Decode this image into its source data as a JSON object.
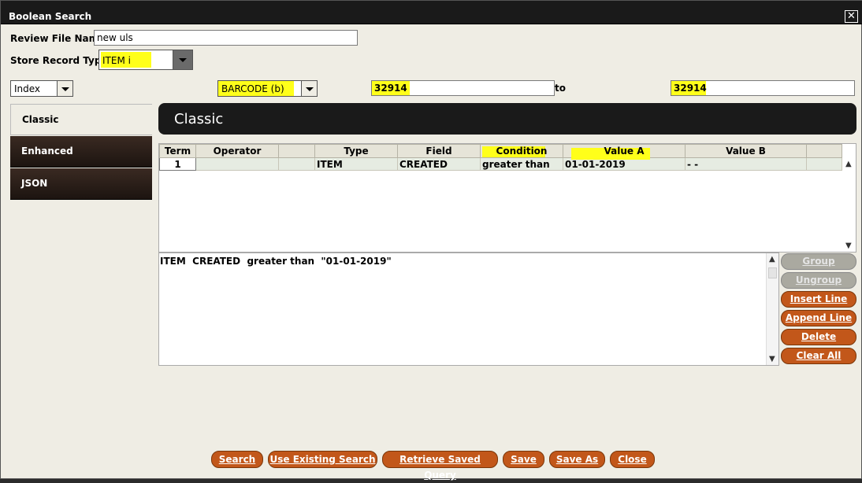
{
  "window": {
    "title": "Boolean Search"
  },
  "review": {
    "label": "Review File Name:",
    "value": "new uls"
  },
  "store": {
    "label": "Store Record Type:",
    "value": "ITEM i"
  },
  "index": {
    "value": "Index"
  },
  "barcode": {
    "value": "BARCODE (b)"
  },
  "range": {
    "from": "32914",
    "to_label": "to",
    "to": "32914"
  },
  "tabs": [
    {
      "label": "Classic"
    },
    {
      "label": "Enhanced"
    },
    {
      "label": "JSON"
    }
  ],
  "banner": {
    "title": "Classic"
  },
  "grid": {
    "headers": [
      "Term",
      "Operator",
      "",
      "Type",
      "Field",
      "Condition",
      "Value A",
      "Value B",
      ""
    ],
    "rows": [
      [
        "1",
        "",
        "",
        "ITEM",
        "CREATED",
        "greater than",
        "01-01-2019",
        "- -",
        ""
      ]
    ]
  },
  "query": {
    "text": "ITEM  CREATED  greater than  \"01-01-2019\""
  },
  "side_buttons": {
    "group": "Group",
    "ungroup": "Ungroup",
    "insert_line": "Insert Line",
    "append_line": "Append Line",
    "delete": "Delete",
    "clear_all": "Clear All"
  },
  "bottom_buttons": {
    "search": "Search",
    "use_existing": "Use Existing Search",
    "retrieve_saved": "Retrieve Saved Query",
    "save": "Save",
    "save_as": "Save As",
    "close": "Close"
  },
  "colors": {
    "accent": "#c2571a",
    "highlight": "#ffff1a",
    "titlebar": "#1a1a1a"
  }
}
